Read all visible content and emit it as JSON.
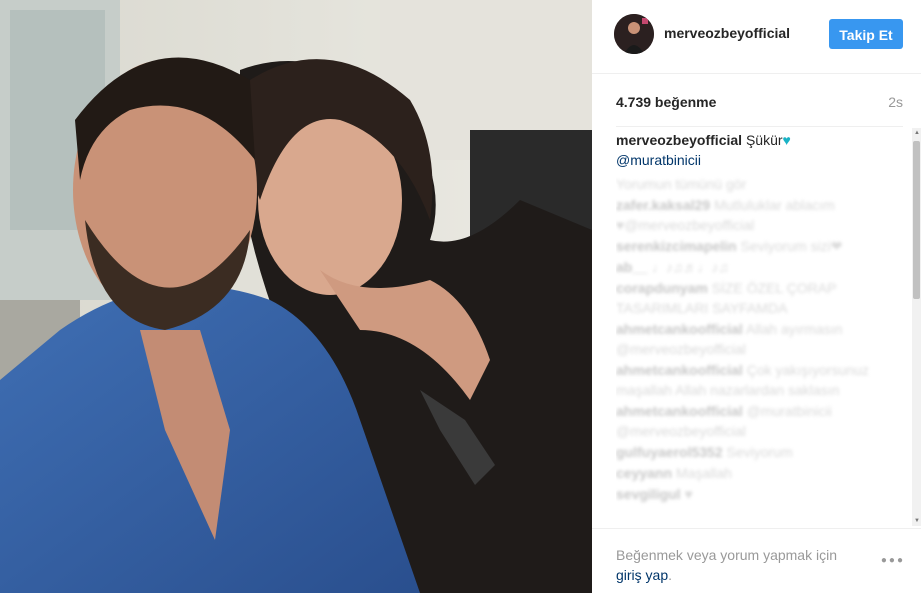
{
  "post": {
    "username": "merveozbeyofficial",
    "follow_label": "Takip Et",
    "likes": "4.739 beğenme",
    "time": "2s",
    "caption": {
      "user": "merveozbeyofficial",
      "text": "Şükür",
      "mention": "@muratbinicii"
    },
    "faded_comments": [
      {
        "user": "",
        "text": "Yorumun tümünü gör"
      },
      {
        "user": "zafer.kaksal29",
        "text": "Mutluluklar ablacım ♥@merveozbeyofficial"
      },
      {
        "user": "serenkizcimapelin",
        "text": "Seviyorum sizi❤"
      },
      {
        "user": "ab__",
        "text": "♩♪♫♬♩♪♫"
      },
      {
        "user": "corapdunyam",
        "text": "SİZE ÖZEL ÇORAP TASARIMLARI SAYFAMDA"
      },
      {
        "user": "ahmetcankoofficial",
        "text": "Allah ayırmasın @merveozbeyofficial"
      },
      {
        "user": "ahmetcankoofficial",
        "text": "Çok yakışıyorsunuz maşallah Allah nazarlardan saklasın"
      },
      {
        "user": "ahmetcankoofficial",
        "text": "@muratbinicii @merveozbeyofficial"
      },
      {
        "user": "gulfuyaerol5352",
        "text": "Seviyorum"
      },
      {
        "user": "ceyyann",
        "text": "Maşallah"
      },
      {
        "user": "sevgiligul",
        "text": "♥"
      }
    ]
  },
  "footer": {
    "text": "Beğenmek veya yorum yapmak için",
    "login": "giriş yap",
    "period": "."
  },
  "icons": {
    "more": "more-options-icon",
    "heart": "heart-emoji"
  },
  "colors": {
    "follow_button": "#3897f0",
    "link": "#003569",
    "muted": "#999999"
  }
}
